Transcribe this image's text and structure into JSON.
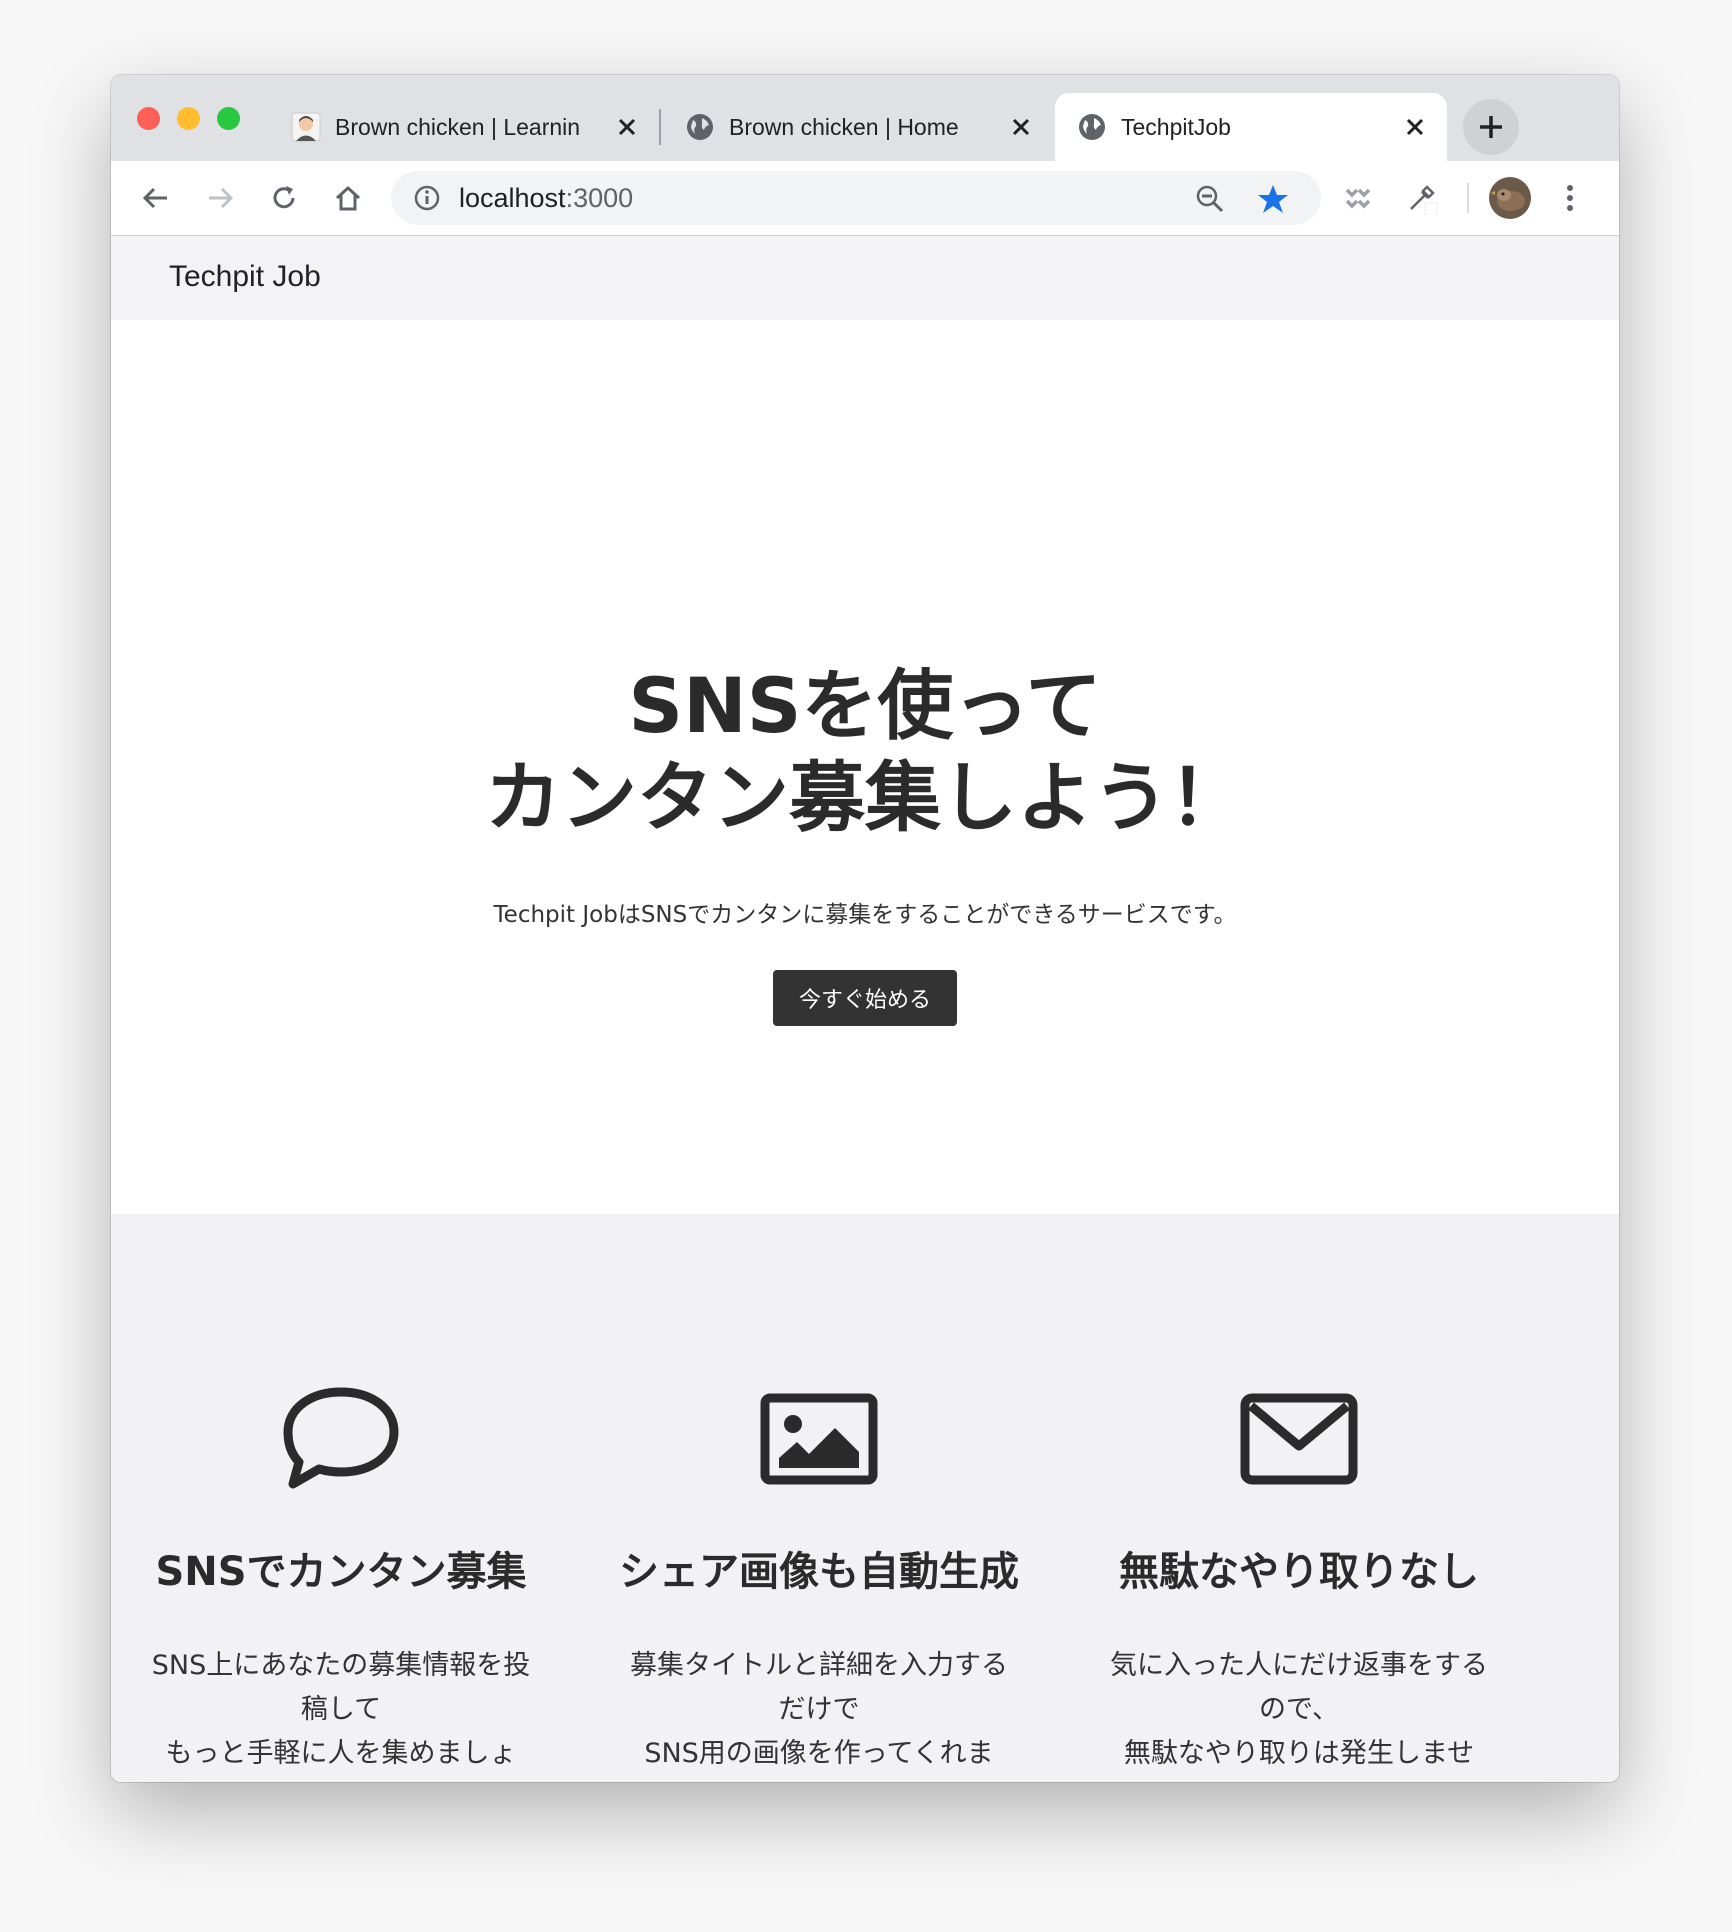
{
  "browser": {
    "tabs": [
      {
        "title": "Brown chicken | Learnin",
        "active": false
      },
      {
        "title": "Brown chicken | Home",
        "active": false
      },
      {
        "title": "TechpitJob",
        "active": true
      }
    ],
    "url_host": "localhost",
    "url_port": ":3000",
    "bookmark_star_color": "#1a73e8"
  },
  "navbar": {
    "brand": "Techpit Job"
  },
  "hero": {
    "title_line1": "SNSを使って",
    "title_line2": "カンタン募集しよう！",
    "lead": "Techpit JobはSNSでカンタンに募集をすることができるサービスです。",
    "cta_label": "今すぐ始める"
  },
  "features": [
    {
      "icon": "speech-bubble-icon",
      "title": "SNSでカンタン募集",
      "desc_line1": "SNS上にあなたの募集情報を投",
      "desc_line2": "稿して",
      "desc_line3": "もっと手軽に人を集めましょ"
    },
    {
      "icon": "image-icon",
      "title": "シェア画像も自動生成",
      "desc_line1": "募集タイトルと詳細を入力する",
      "desc_line2": "だけで",
      "desc_line3": "SNS用の画像を作ってくれま"
    },
    {
      "icon": "envelope-icon",
      "title": "無駄なやり取りなし",
      "desc_line1": "気に入った人にだけ返事をする",
      "desc_line2": "ので、",
      "desc_line3": "無駄なやり取りは発生しませ"
    }
  ]
}
